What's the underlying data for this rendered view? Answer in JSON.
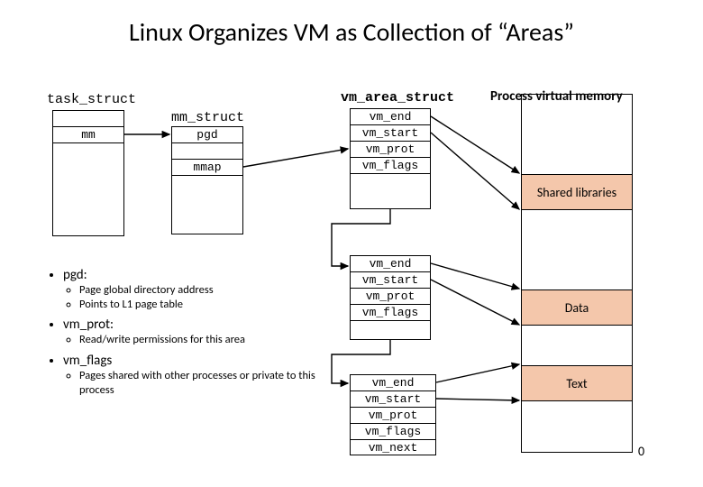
{
  "title": "Linux Organizes VM as Collection of “Areas”",
  "labels": {
    "task_struct": "task_struct",
    "mm_struct": "mm_struct",
    "vm_area_struct": "vm_area_struct",
    "process_vm": "Process virtual memory"
  },
  "task_struct_rows": {
    "mm": "mm"
  },
  "mm_struct_rows": {
    "pgd": "pgd",
    "mmap": "mmap"
  },
  "vm_area1": {
    "vm_end": "vm_end",
    "vm_start": "vm_start",
    "vm_prot": "vm_prot",
    "vm_flags": "vm_flags"
  },
  "vm_area2": {
    "vm_end": "vm_end",
    "vm_start": "vm_start",
    "vm_prot": "vm_prot",
    "vm_flags": "vm_flags"
  },
  "vm_area3": {
    "vm_end": "vm_end",
    "vm_start": "vm_start",
    "vm_prot": "vm_prot",
    "vm_flags": "vm_flags",
    "vm_next": "vm_next"
  },
  "memory_segments": {
    "shared": "Shared libraries",
    "data": "Data",
    "text": "Text"
  },
  "zero_label": "0",
  "notes": {
    "pgd_h": "pgd:",
    "pgd_b1": "Page global directory address",
    "pgd_b2": "Points to L1 page table",
    "vm_prot_h": "vm_prot:",
    "vm_prot_b1": "Read/write permissions for this area",
    "vm_flags_h": "vm_flags",
    "vm_flags_b1": "Pages shared with other processes or private to this process"
  }
}
